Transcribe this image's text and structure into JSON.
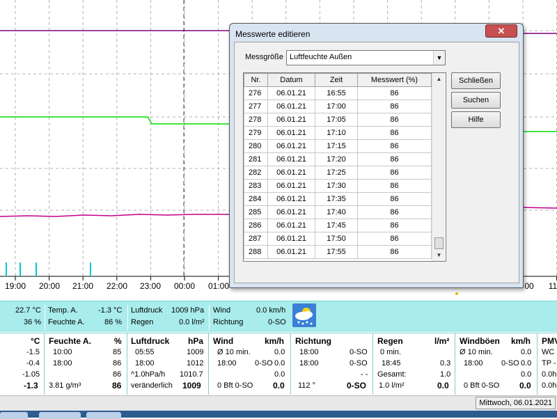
{
  "chart": {
    "time_labels": [
      "19:00",
      "20:00",
      "21:00",
      "22:00",
      "23:00",
      "00:00",
      "01:00",
      "",
      "",
      "",
      "",
      "",
      "",
      ""
    ],
    "visible_time_labels": [
      "19:00",
      "20:00",
      "21:00",
      "22:00",
      "23:00",
      "00:00",
      "01:00"
    ],
    "right_partial_labels": [
      "00",
      "11"
    ],
    "colors": {
      "purple": "#800080",
      "green": "#00dd00",
      "magenta": "#c0008a",
      "rain": "#00c8d0",
      "grid": "#b0b0b0"
    }
  },
  "summary": {
    "temp_inside": "22.7 °C",
    "humidity_inside": "36 %",
    "temp_out_label": "Temp. A.",
    "temp_out_value": "-1.3 °C",
    "hum_out_label": "Feuchte A.",
    "hum_out_value": "86 %",
    "pressure_label": "Luftdruck",
    "pressure_value": "1009 hPa",
    "rain_label": "Regen",
    "rain_value": "0.0 l/m²",
    "wind_label": "Wind",
    "wind_value": "0.0 km/h",
    "direction_label": "Richtung",
    "direction_value": "0-SO",
    "weather_icon": "cloud-snow-icon"
  },
  "detail": {
    "temp": {
      "unit": "°C",
      "rows": [
        "-1.5",
        "-0.4",
        "-1.05"
      ],
      "current": "-1.3"
    },
    "humidity": {
      "title": "Feuchte A.",
      "unit": "%",
      "rows": [
        [
          "10:00",
          "85"
        ],
        [
          "18:00",
          "86"
        ],
        [
          "",
          "86"
        ]
      ],
      "abs": "3.81 g/m³",
      "current": "86"
    },
    "pressure": {
      "title": "Luftdruck",
      "unit": "hPa",
      "rows": [
        [
          "05:55",
          "1009"
        ],
        [
          "18:00",
          "1012"
        ],
        [
          "^1.0hPa/h",
          "1010.7"
        ]
      ],
      "trend": "veränderlich",
      "current": "1009"
    },
    "wind": {
      "title": "Wind",
      "unit": "km/h",
      "rows": [
        [
          "Ø 10 min.",
          "0.0"
        ],
        [
          "18:00",
          "0-SO",
          "0.0"
        ],
        [
          "",
          "0.0"
        ]
      ],
      "bft": "0 Bft 0-SO",
      "current": "0.0"
    },
    "direction": {
      "title": "Richtung",
      "rows": [
        [
          "18:00",
          "0-SO"
        ],
        [
          "18:00",
          "0-SO"
        ],
        [
          "",
          "- -"
        ]
      ],
      "deg": "112 °",
      "current": "0-SO"
    },
    "rain": {
      "title": "Regen",
      "unit": "l/m²",
      "rows": [
        [
          "0 min.",
          ""
        ],
        [
          "18:45",
          "0.3"
        ],
        [
          "Gesamt:",
          "1.0"
        ]
      ],
      "rate": "1.0 l/m²",
      "current": "0.0"
    },
    "gusts": {
      "title": "Windböen",
      "unit": "km/h",
      "rows": [
        [
          "Ø 10 min.",
          "0.0"
        ],
        [
          "18:00",
          "0-SO",
          "0.0"
        ],
        [
          "",
          "0.0"
        ]
      ],
      "bft": "0 Bft 0-SO",
      "current": "0.0"
    },
    "pmv": {
      "title": "PMV",
      "rows": [
        "WC",
        "TP -",
        "0.0h",
        "0.0h"
      ]
    }
  },
  "status": {
    "date": "Mittwoch, 06.01.2021"
  },
  "dialog": {
    "title": "Messwerte editieren",
    "close": "✕",
    "messgroesse_label": "Messgröße",
    "messgroesse_value": "Luftfeuchte Außen",
    "columns": [
      "Nr.",
      "Datum",
      "Zeit",
      "Messwert (%)"
    ],
    "rows": [
      [
        "276",
        "06.01.21",
        "16:55",
        "86"
      ],
      [
        "277",
        "06.01.21",
        "17:00",
        "86"
      ],
      [
        "278",
        "06.01.21",
        "17:05",
        "86"
      ],
      [
        "279",
        "06.01.21",
        "17:10",
        "86"
      ],
      [
        "280",
        "06.01.21",
        "17:15",
        "86"
      ],
      [
        "281",
        "06.01.21",
        "17:20",
        "86"
      ],
      [
        "282",
        "06.01.21",
        "17:25",
        "86"
      ],
      [
        "283",
        "06.01.21",
        "17:30",
        "86"
      ],
      [
        "284",
        "06.01.21",
        "17:35",
        "86"
      ],
      [
        "285",
        "06.01.21",
        "17:40",
        "86"
      ],
      [
        "286",
        "06.01.21",
        "17:45",
        "86"
      ],
      [
        "287",
        "06.01.21",
        "17:50",
        "86"
      ],
      [
        "288",
        "06.01.21",
        "17:55",
        "86"
      ]
    ],
    "buttons": {
      "close": "Schließen",
      "search": "Suchen",
      "help": "Hilfe"
    }
  }
}
